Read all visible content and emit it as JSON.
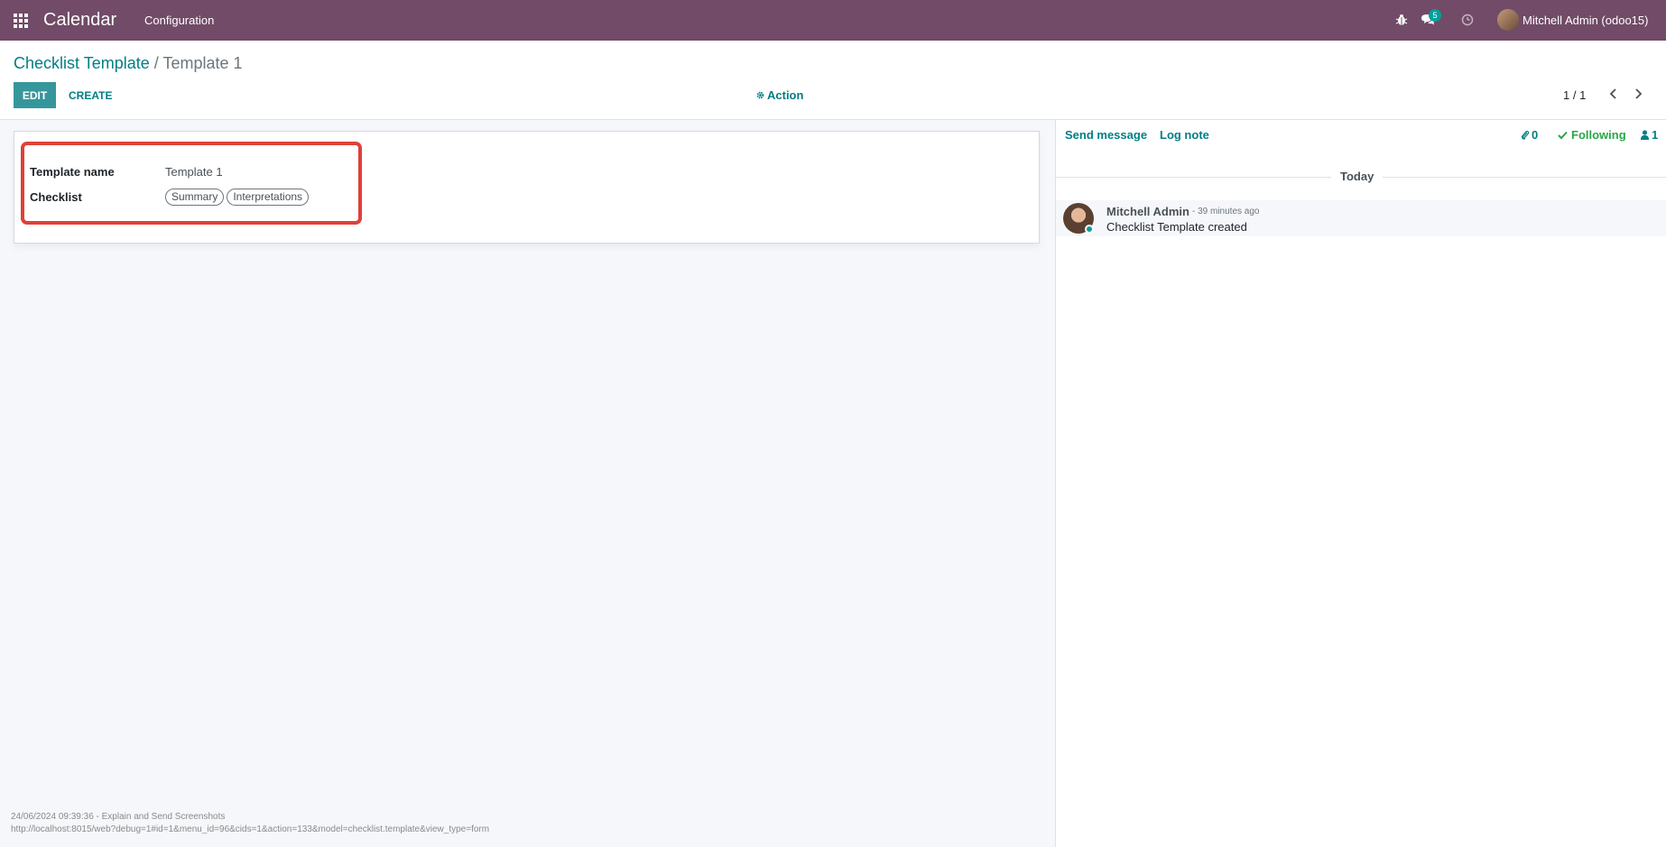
{
  "navbar": {
    "app_name": "Calendar",
    "menu_configuration": "Configuration",
    "chat_count": "5",
    "user_name": "Mitchell Admin (odoo15)"
  },
  "breadcrumb": {
    "parent": "Checklist Template",
    "separator": "/",
    "current": "Template 1"
  },
  "toolbar": {
    "edit_label": "EDIT",
    "create_label": "CREATE",
    "action_label": "Action"
  },
  "pager": {
    "value": "1 / 1"
  },
  "form": {
    "template_name_label": "Template name",
    "template_name_value": "Template 1",
    "checklist_label": "Checklist",
    "checklist_tags": [
      "Summary",
      "Interpretations"
    ]
  },
  "chatter": {
    "send_message": "Send message",
    "log_note": "Log note",
    "attachments_count": "0",
    "following_label": "Following",
    "followers_count": "1",
    "today_label": "Today",
    "messages": [
      {
        "author": "Mitchell Admin",
        "time": "- 39 minutes ago",
        "body": "Checklist Template created"
      }
    ]
  },
  "footer": {
    "line1": "24/06/2024 09:39:36 - Explain and Send Screenshots",
    "line2": "http://localhost:8015/web?debug=1#id=1&menu_id=96&cids=1&action=133&model=checklist.template&view_type=form"
  },
  "colors": {
    "navbar": "#714b67",
    "primary": "#35979c",
    "link": "#017e84",
    "highlight": "#e0403a",
    "following": "#28a745"
  }
}
